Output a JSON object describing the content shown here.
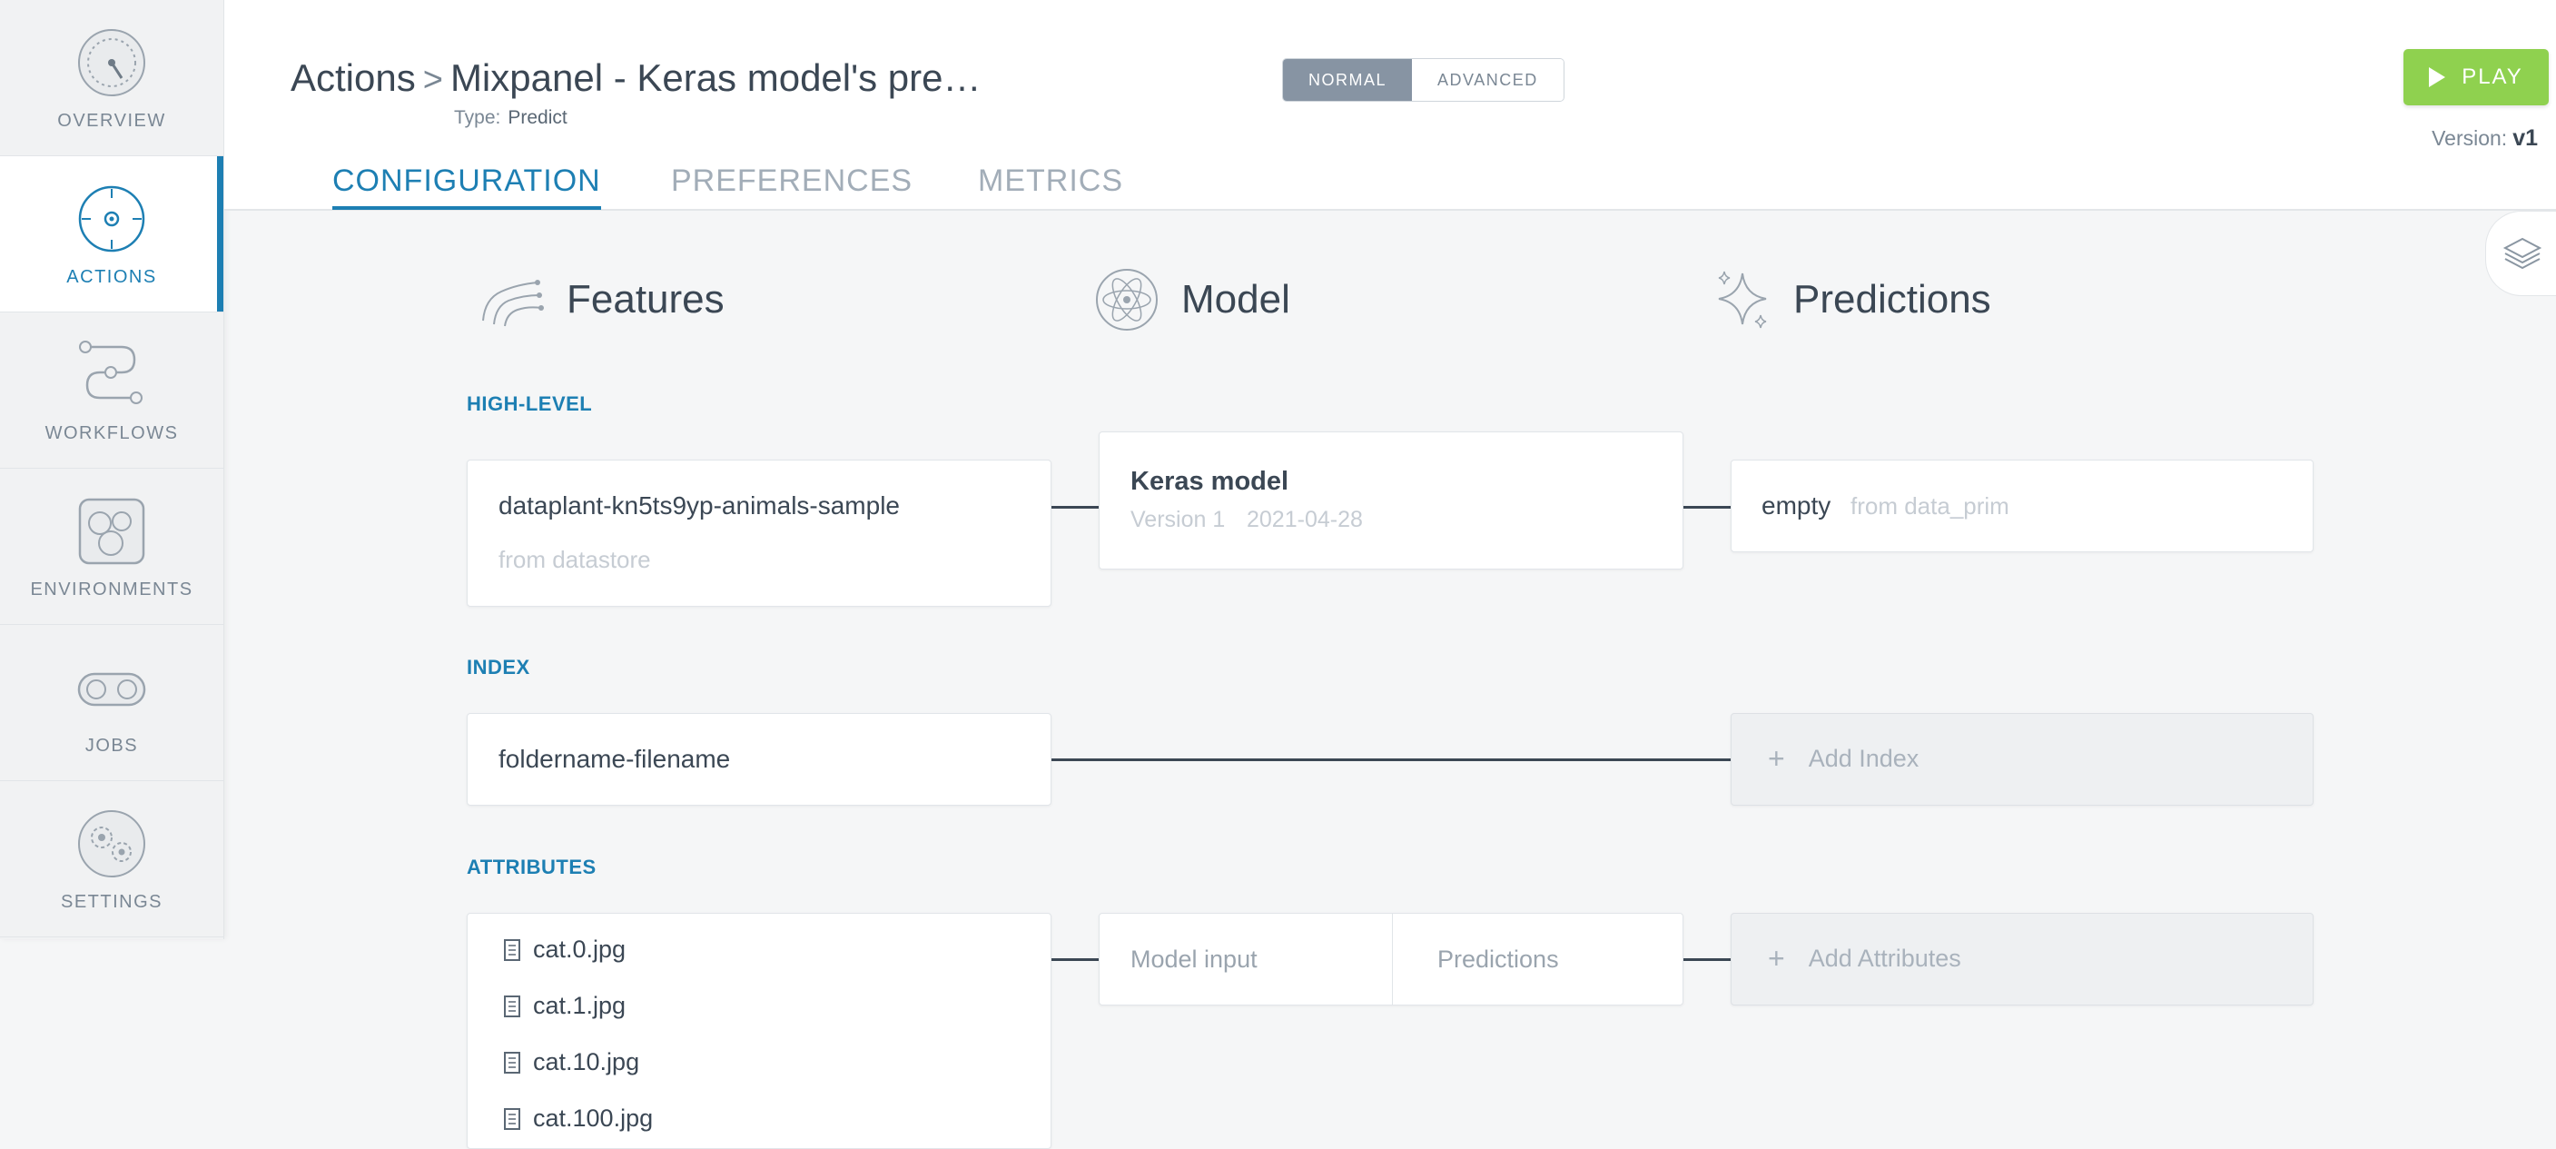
{
  "sidebar": {
    "items": [
      {
        "label": "OVERVIEW",
        "icon": "gauge-icon",
        "active": false
      },
      {
        "label": "ACTIONS",
        "icon": "target-icon",
        "active": true
      },
      {
        "label": "WORKFLOWS",
        "icon": "workflow-icon",
        "active": false
      },
      {
        "label": "ENVIRONMENTS",
        "icon": "environment-icon",
        "active": false
      },
      {
        "label": "JOBS",
        "icon": "jobs-icon",
        "active": false
      },
      {
        "label": "SETTINGS",
        "icon": "gears-icon",
        "active": false
      }
    ]
  },
  "header": {
    "breadcrumb_root": "Actions",
    "breadcrumb_sep": ">",
    "title": "Mixpanel - Keras model's pre…",
    "type_label": "Type:",
    "type_value": "Predict",
    "modes": [
      "NORMAL",
      "ADVANCED"
    ],
    "active_mode": "NORMAL",
    "play_label": "PLAY",
    "version_label": "Version:",
    "version_value": "v1",
    "tabs": [
      "CONFIGURATION",
      "PREFERENCES",
      "METRICS"
    ],
    "active_tab": "CONFIGURATION"
  },
  "columns": {
    "features": "Features",
    "model": "Model",
    "predictions": "Predictions"
  },
  "high_level": {
    "label": "HIGH-LEVEL",
    "feature_name": "dataplant-kn5ts9yp-animals-sample",
    "feature_source": "from datastore",
    "model_name": "Keras model",
    "model_version": "Version 1",
    "model_date": "2021-04-28",
    "prediction_name": "empty",
    "prediction_source": "from data_prim"
  },
  "index": {
    "label": "INDEX",
    "feature": "foldername-filename",
    "add_label": "Add Index"
  },
  "attributes": {
    "label": "ATTRIBUTES",
    "files": [
      "cat.0.jpg",
      "cat.1.jpg",
      "cat.10.jpg",
      "cat.100.jpg"
    ],
    "model_input": "Model input",
    "model_output": "Predictions",
    "add_label": "Add Attributes"
  },
  "colors": {
    "accent": "#1d7fb3",
    "play": "#8fd14f",
    "mode_active": "#8794a3"
  }
}
